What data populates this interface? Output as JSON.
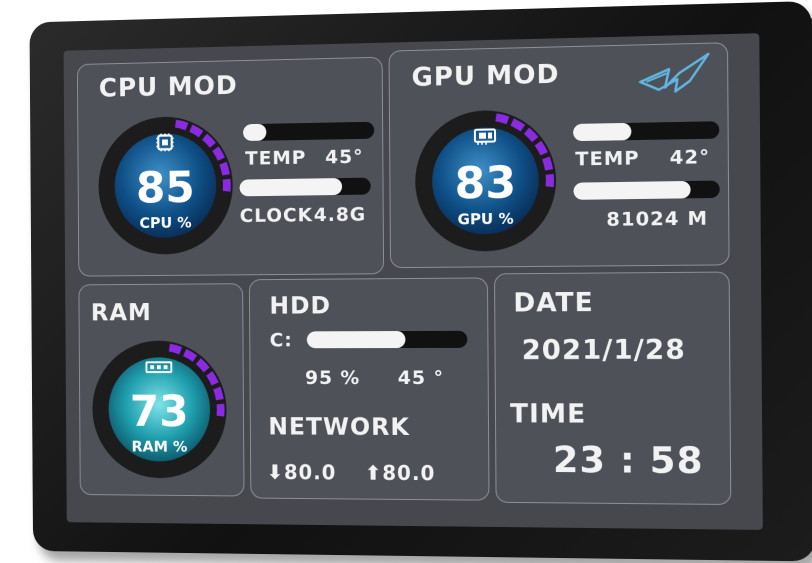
{
  "cpu": {
    "title": "CPU MOD",
    "value": "85",
    "unit": "CPU %",
    "temp_label": "TEMP",
    "temp_value": "45°",
    "temp_level": 0.18,
    "clock_label": "CLOCK",
    "clock_value": "4.8G",
    "clock_level": 0.78,
    "icon": "chip-icon"
  },
  "gpu": {
    "title": "GPU MOD",
    "value": "83",
    "unit": "GPU %",
    "temp_label": "TEMP",
    "temp_value": "42°",
    "temp_level": 0.4,
    "mem_value": "81024 M",
    "mem_level": 0.8,
    "icon": "gpu-card-icon",
    "logo": "rog-logo"
  },
  "ram": {
    "title": "RAM",
    "value": "73",
    "unit": "RAM %",
    "icon": "ram-stick-icon"
  },
  "hdd": {
    "title": "HDD",
    "drive_label": "C:",
    "drive_level": 0.62,
    "usage": "95 %",
    "temp": "45 °"
  },
  "network": {
    "title": "NETWORK",
    "down": "80.0",
    "up": "80.0"
  },
  "date": {
    "title": "DATE",
    "value": "2021/1/28"
  },
  "time": {
    "title": "TIME",
    "value": "23 : 58"
  },
  "colors": {
    "accent": "#8a2be2",
    "gauge_ring": "#1c1c1c",
    "panel": "#4e5158",
    "screen": "#46484e"
  }
}
